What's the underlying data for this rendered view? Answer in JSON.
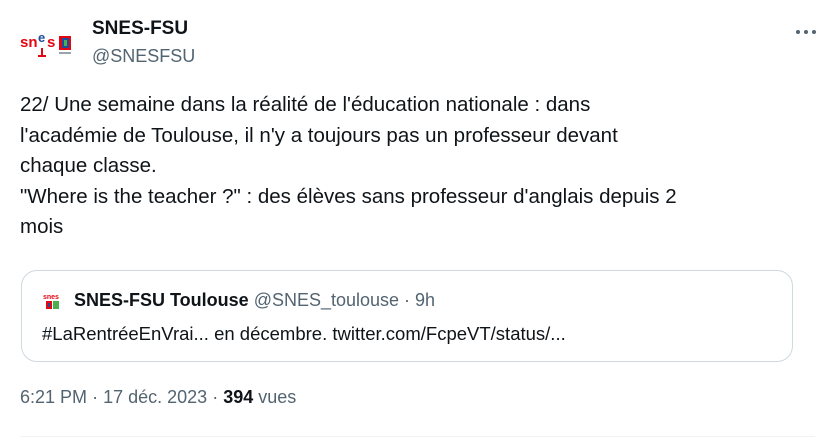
{
  "author": {
    "display_name": "SNES-FSU",
    "handle": "@SNESFSU"
  },
  "tweet": {
    "text": "22/ Une semaine dans la réalité de l'éducation nationale : dans\nl'académie de Toulouse, il n'y a toujours pas un professeur devant\nchaque classe.\n\"Where is the teacher ?\" : des élèves sans professeur d'anglais depuis 2\nmois"
  },
  "quote": {
    "display_name": "SNES-FSU Toulouse",
    "handle": "@SNES_toulouse",
    "separator": "·",
    "time": "9h",
    "text": "#LaRentréeEnVrai... en décembre. twitter.com/FcpeVT/status/..."
  },
  "meta": {
    "time": "6:21 PM",
    "separator": "·",
    "date": "17 déc. 2023",
    "views_count": "394",
    "views_label": "vues"
  },
  "icons": {
    "avatar": "snes-fsu-logo",
    "more": "more-options-icon",
    "quote_avatar": "snes-fsu-toulouse-logo"
  },
  "colors": {
    "text": "#0f1419",
    "secondary": "#536471",
    "border": "#cfd9de",
    "logo_red": "#e30613",
    "logo_blue": "#1d4e9e",
    "logo_green": "#4caf50"
  }
}
